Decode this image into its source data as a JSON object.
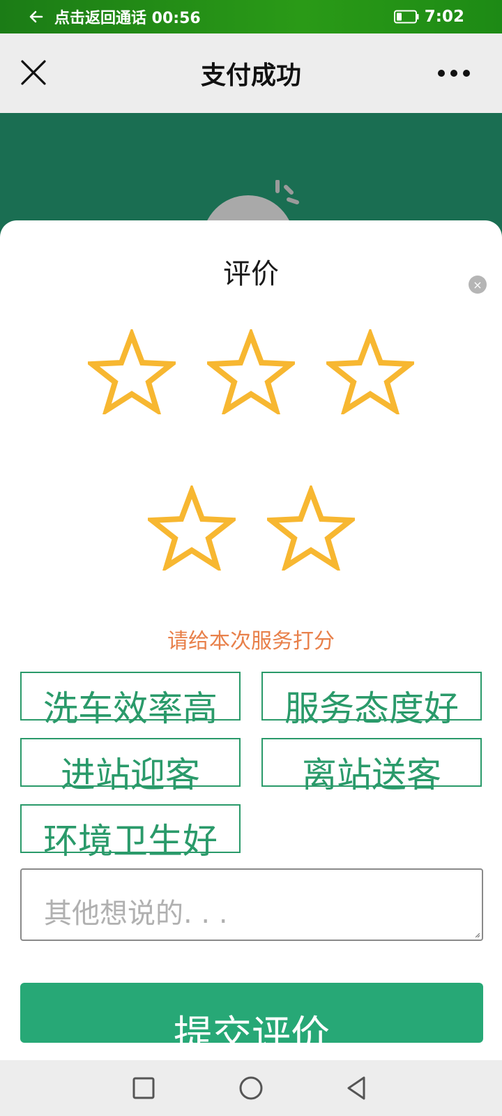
{
  "status_bar": {
    "call_text": "点击返回通话 00:56",
    "time": "7:02"
  },
  "title_bar": {
    "title": "支付成功"
  },
  "rating": {
    "title": "评价",
    "close_symbol": "×",
    "star_count": 5,
    "stars_filled": 0,
    "star_color": "#f7b731",
    "prompt": "请给本次服务打分"
  },
  "tags": [
    "洗车效率高",
    "服务态度好",
    "进站迎客",
    "离站送客",
    "环境卫生好"
  ],
  "comment": {
    "placeholder": "其他想说的. . ."
  },
  "submit": {
    "label": "提交评价"
  },
  "colors": {
    "accent_green": "#27a876",
    "header_green": "#1a6e52",
    "prompt_orange": "#e8804a"
  },
  "icons": {
    "back": "arrow-left-icon",
    "battery": "battery-icon",
    "close": "close-icon",
    "more": "more-icon",
    "star": "star-outline-icon",
    "nav_recent": "square-icon",
    "nav_home": "circle-icon",
    "nav_back": "triangle-back-icon"
  }
}
